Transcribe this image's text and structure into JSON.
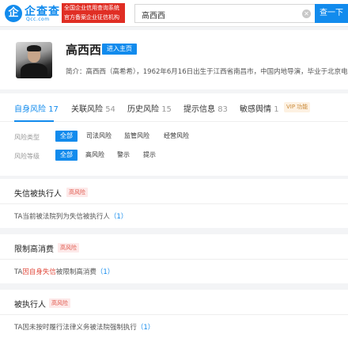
{
  "header": {
    "logo_icon": "企",
    "logo_name": "企查查",
    "logo_sub": "Qcc.com",
    "badge_line1": "全国企业信用查询系统",
    "badge_line2": "官方备案企业征信机构",
    "search_value": "高西西",
    "search_button": "查一下"
  },
  "profile": {
    "name": "高西西",
    "home_button": "进入主页",
    "intro": "简介：高西西（高希希），1962年6月16日出生于江西省南昌市，中国内地导演，毕业于北京电影学院"
  },
  "tabs": [
    {
      "label": "自身风险",
      "count": "17"
    },
    {
      "label": "关联风险",
      "count": "54"
    },
    {
      "label": "历史风险",
      "count": "15"
    },
    {
      "label": "提示信息",
      "count": "83"
    },
    {
      "label": "敏感舆情",
      "count": "1"
    }
  ],
  "vip_label": "VIP 功能",
  "filters": {
    "type_label": "风险类型",
    "type_options": [
      "全部",
      "司法风险",
      "监管风险",
      "经营风险"
    ],
    "level_label": "风险等级",
    "level_options": [
      "全部",
      "高风险",
      "警示",
      "提示"
    ]
  },
  "risk_cards": [
    {
      "title": "失信被执行人",
      "tag": "高风险",
      "text": "TA当前被法院列为失信被执行人",
      "count": "（1）"
    },
    {
      "title": "限制高消费",
      "tag": "高风险",
      "prefix": "TA",
      "highlight": "因自身失信",
      "suffix": "被限制高消费",
      "count": "（1）"
    },
    {
      "title": "被执行人",
      "tag": "高风险",
      "text": "TA因未按时履行法律义务被法院强制执行",
      "count": "（1）"
    }
  ],
  "colors": {
    "accent": "#128bed",
    "danger": "#e0584b"
  }
}
